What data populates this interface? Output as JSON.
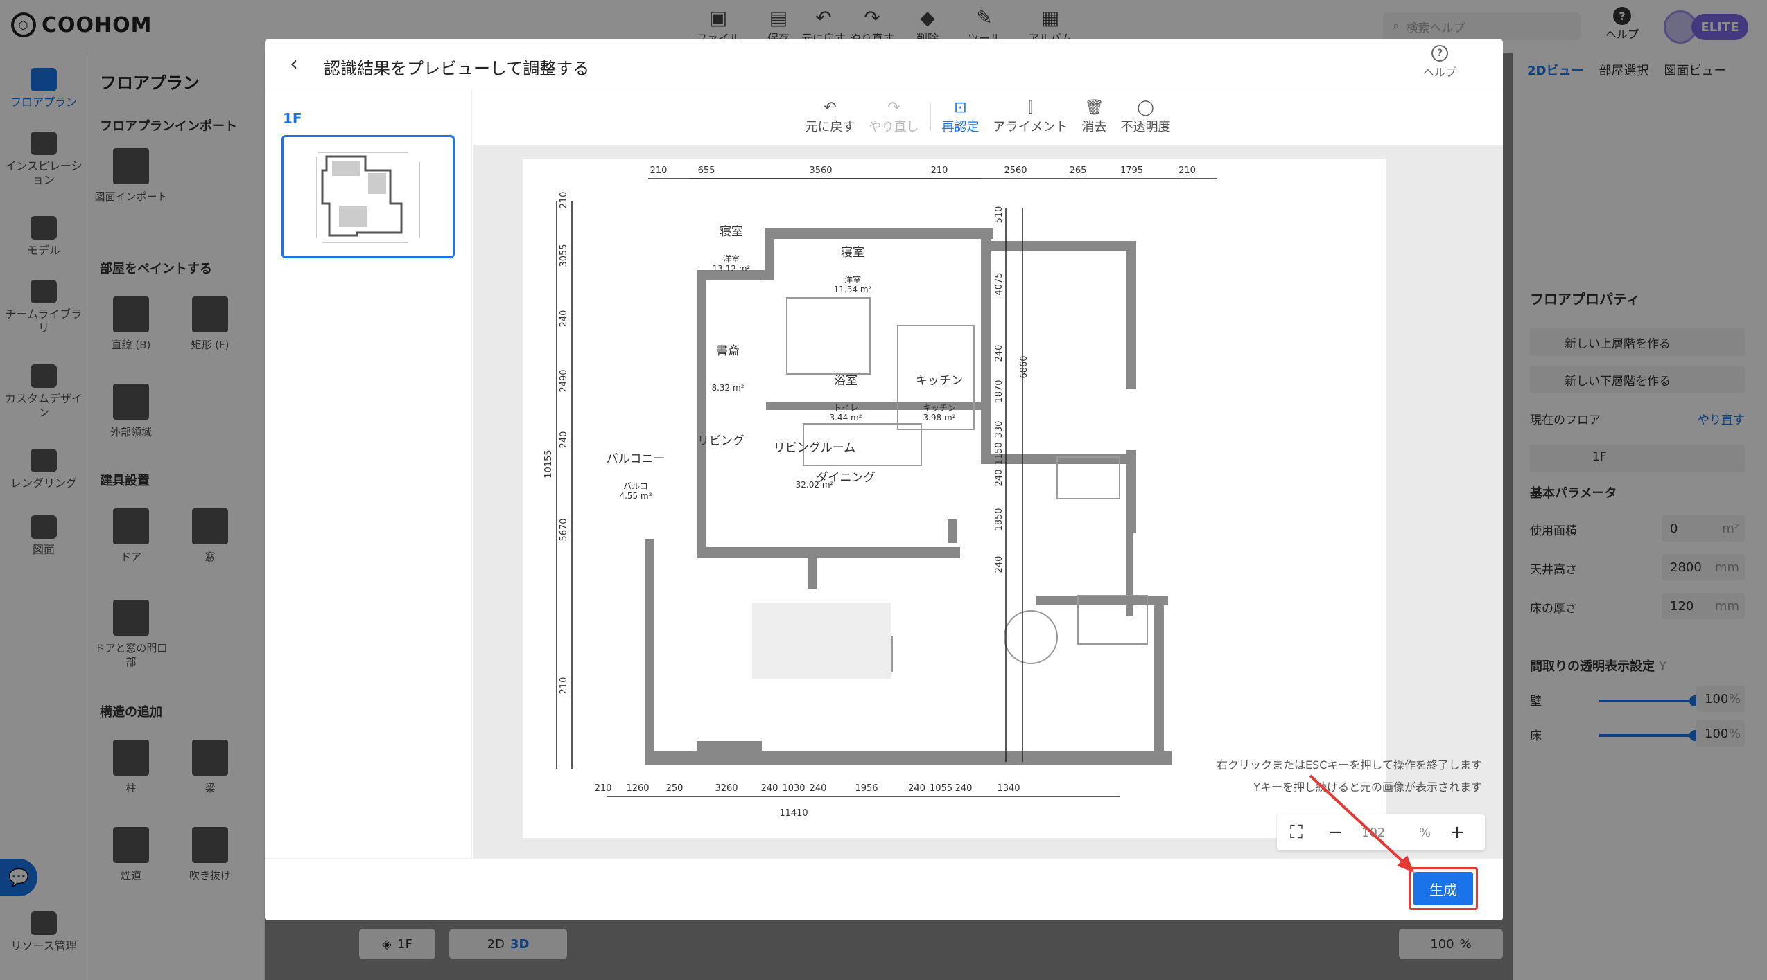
{
  "app": {
    "logo": "COOHOM",
    "toolbar": [
      {
        "label": "ファイル",
        "icon": "file-icon"
      },
      {
        "label": "保存",
        "icon": "save-icon"
      },
      {
        "label": "元に戻す",
        "icon": "undo-icon"
      },
      {
        "label": "やり直す",
        "icon": "redo-icon"
      },
      {
        "label": "削除",
        "icon": "eraser-icon"
      },
      {
        "label": "ツール",
        "icon": "wrench-icon"
      },
      {
        "label": "アルバム",
        "icon": "album-icon"
      }
    ],
    "search_placeholder": "検索ヘルプ",
    "help_label": "ヘルプ",
    "badge": "ELITE"
  },
  "rail": [
    {
      "label": "フロアプラン",
      "active": true
    },
    {
      "label": "インスピレーション"
    },
    {
      "label": "モデル"
    },
    {
      "label": "チームライブラリ"
    },
    {
      "label": "カスタムデザイン"
    },
    {
      "label": "レンダリング"
    },
    {
      "label": "図面"
    },
    {
      "label": "リソース管理"
    }
  ],
  "left_panel": {
    "title": "フロアプラン",
    "import_section": "フロアプランインポート",
    "import_tile": "図面インポート",
    "paint_section": "部屋をペイントする",
    "paint_tiles": [
      "直線 (B)",
      "矩形 (F)",
      "外部領域"
    ],
    "fixture_section": "建具設置",
    "fixture_tiles": [
      "ドア",
      "窓",
      "ドアと窓の開口部"
    ],
    "structure_section": "構造の追加",
    "structure_tiles": [
      "柱",
      "梁",
      "煙道",
      "吹き抜け"
    ]
  },
  "right_panel": {
    "tabs": [
      "2Dビュー",
      "部屋選択",
      "図面ビュー"
    ],
    "floor_props": "フロアプロパティ",
    "btn_upper": "新しい上層階を作る",
    "btn_lower": "新しい下層階を作る",
    "current_floor": "現在のフロア",
    "reset": "やり直す",
    "floor_value": "1F",
    "basic_params": "基本パラメータ",
    "area_label": "使用面積",
    "area_value": "0",
    "area_unit": "m²",
    "ceiling_label": "天井高さ",
    "ceiling_value": "2800",
    "ceiling_unit": "mm",
    "floor_thick_label": "床の厚さ",
    "floor_thick_value": "120",
    "floor_thick_unit": "mm",
    "transparency": "間取りの透明表示設定",
    "transparency_key": "Y",
    "wall_label": "壁",
    "wall_value": "100",
    "floor_label": "床",
    "floor_value2": "100",
    "pct": "%"
  },
  "bottom_bar": {
    "floor": "1F",
    "view2d": "2D",
    "view3d": "3D",
    "zoom": "100",
    "pct": "%"
  },
  "modal": {
    "title": "認識結果をプレビューして調整する",
    "help": "ヘルプ",
    "floor_tab": "1F",
    "tools": [
      {
        "label": "元に戻す",
        "icon": "undo-icon",
        "state": "normal"
      },
      {
        "label": "やり直し",
        "icon": "redo-icon",
        "state": "disabled"
      },
      {
        "label": "再認定",
        "icon": "ai-recognize-icon",
        "state": "active"
      },
      {
        "label": "アライメント",
        "icon": "align-icon",
        "state": "normal"
      },
      {
        "label": "消去",
        "icon": "trash-icon",
        "state": "normal"
      },
      {
        "label": "不透明度",
        "icon": "opacity-icon",
        "state": "normal"
      }
    ],
    "hint1": "右クリックまたはESCキーを押して操作を終了します",
    "hint2": "Yキーを押し続けると元の画像が表示されます",
    "zoom_value": "102",
    "zoom_pct": "%",
    "generate": "生成",
    "plan": {
      "top_dims": [
        "210",
        "655",
        "3560",
        "210",
        "2560",
        "265",
        "1795",
        "210"
      ],
      "bottom_dims": [
        "210",
        "1260",
        "250",
        "3260",
        "240",
        "1030",
        "240",
        "1956",
        "240",
        "1055",
        "240",
        "1340"
      ],
      "bottom_total": "11410",
      "left_dims": [
        "210",
        "3055",
        "240",
        "2490",
        "240",
        "5670",
        "210"
      ],
      "left_total": "10155",
      "right_dims": [
        "510",
        "4075",
        "240",
        "1870",
        "330",
        "1150",
        "240",
        "1850",
        "240"
      ],
      "right_total": "6860",
      "rooms": [
        {
          "name": "寝室",
          "sub": "洋室",
          "area": "13.12 m²"
        },
        {
          "name": "寝室",
          "sub": "洋室",
          "area": "11.34 m²"
        },
        {
          "name": "書斎",
          "area": "8.32 m²"
        },
        {
          "name": "浴室",
          "sub": "トイレ",
          "area": "3.44 m²"
        },
        {
          "name": "キッチン",
          "sub": "キッチン",
          "area": "3.98 m²"
        },
        {
          "name": "バルコニー",
          "sub": "バルコ",
          "area": "4.55 m²"
        },
        {
          "name": "リビング"
        },
        {
          "name": "リビングルーム",
          "area": "32.02 m²"
        },
        {
          "name": "ダイニング"
        }
      ]
    }
  }
}
